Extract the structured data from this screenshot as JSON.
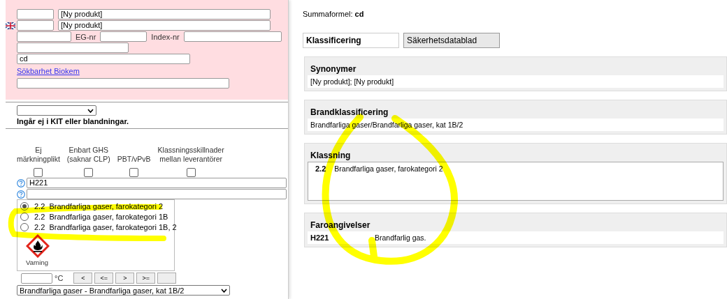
{
  "left_form": {
    "name_fields": [
      {
        "value": "[Ny produkt]",
        "flag": false
      },
      {
        "value": "[Ny produkt]",
        "flag": true
      }
    ],
    "eg_label": "EG-nr",
    "index_label": "Index-nr",
    "formula_value": "cd",
    "link": "Sökbarhet Biokem",
    "kit_note": "Ingår ej i KIT eller blandningar.",
    "flags": [
      {
        "label": "Ej\nmärkningplikt",
        "checked": false
      },
      {
        "label": "Enbart GHS\n(saknar CLP)",
        "checked": false
      },
      {
        "label": "PBT/vPvB",
        "checked": false
      },
      {
        "label": "Klassningsskillnader\nmellan leverantörer",
        "checked": false
      }
    ],
    "hazard_statement": "H221",
    "classes": [
      {
        "code": "2.2",
        "text": "Brandfarliga gaser, farokategori 2",
        "selected": true
      },
      {
        "code": "2.2",
        "text": "Brandfarliga gaser, farokategori 1B",
        "selected": false
      },
      {
        "code": "2.2",
        "text": "Brandfarliga gaser, farokategori 1B, 2",
        "selected": false
      }
    ],
    "pictogram_label": "Varning",
    "unit": "°C",
    "operators": [
      "<",
      "<=",
      ">",
      ">="
    ],
    "fire_class_select": "Brandfarliga gaser - Brandfarliga gaser, kat 1B/2"
  },
  "summary": {
    "label": "Summaformel:",
    "value": "cd"
  },
  "tabs": [
    {
      "label": "Klassificering",
      "selected": true
    },
    {
      "label": "Säkerhetsdatablad",
      "selected": false
    }
  ],
  "sections": [
    {
      "kind": "text",
      "title": "Synonymer",
      "text": "[Ny produkt]; [Ny produkt]"
    },
    {
      "kind": "text",
      "title": "Brandklassificering",
      "text": "Brandfarliga gaser/Brandfarliga gaser, kat 1B/2"
    },
    {
      "kind": "box",
      "title": "Klassning",
      "code": "2.2",
      "text": "Brandfarliga gaser, farokategori 2"
    },
    {
      "kind": "code",
      "title": "Faroangivelser",
      "code": "H221",
      "text": "Brandfarlig gas."
    }
  ]
}
